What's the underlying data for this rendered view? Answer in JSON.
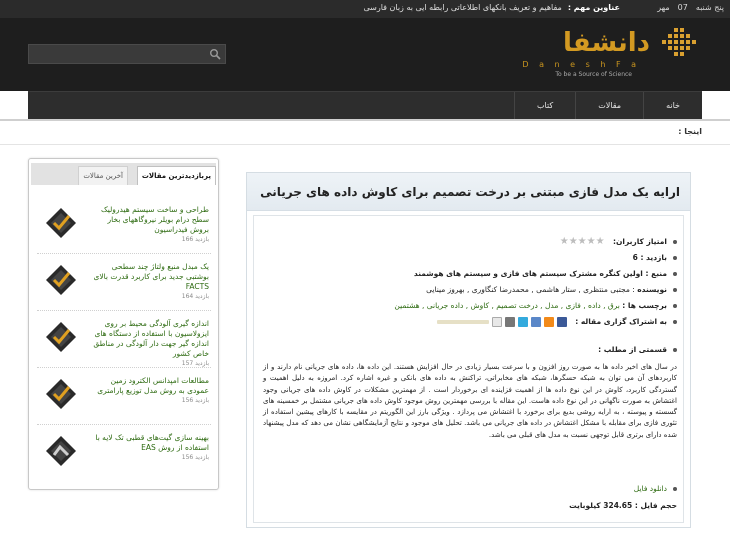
{
  "topbar": {
    "day": "پنج شنبه",
    "date_day": "07",
    "month": "مهر",
    "headlines_label": "عناوین مهم :",
    "headline": "مفاهیم و تعریف بانکهای اطلاعاتی رابطه ایی به زبان فارسی"
  },
  "header": {
    "search_placeholder": "",
    "logo_fa": "دانشفا",
    "logo_en": "D a n e s h  F a",
    "logo_tagline": "To be a Source of Science"
  },
  "nav": {
    "items": [
      "خانه",
      "مقالات",
      "کتاب"
    ]
  },
  "breadcrumb": "اینجا :",
  "sidebar": {
    "tab_active": "پربازدیدترین مقالات",
    "tab_inactive": "آخرین مقالات",
    "entries": [
      {
        "title": "طراحی و ساخت سیستم هیدرولیک سطح درام بویلر نیروگاههای بخار بروش فیدراسیون",
        "views": "بازدید 166"
      },
      {
        "title": "یک مبدل منبع ولتاژ چند سطحی بوشتبی جدید برای کاربرد قدرت بالای FACTS",
        "views": "بازدید 164"
      },
      {
        "title": "اندازه گیری آلودگی محیط بر روی ایزولاسیون با استفاده از دستگاه های اندازه گیر جهت دار آلودگی در مناطق خاص کشور",
        "views": "بازدید 157"
      },
      {
        "title": "مطالعات امپدانس الکترود زمین عمودی به روش مدل توزیع پارامتری",
        "views": "بازدید 156"
      },
      {
        "title": "بهینه سازی گیت‌های قطبی تک لایه با استفاده از روش EAS",
        "views": "بازدید 156"
      }
    ]
  },
  "article": {
    "title": "ارایه یک مدل فازی مبتنی بر درخت تصمیم برای کاوش داده های جریانی",
    "rating_label": "امتیاز کاربران:",
    "rating_value": 0,
    "rating_max": 5,
    "views": "بازدید : 6",
    "source": "منبع : اولین کنگره مشترک سیستم های فازی و سیستم های هوشمند",
    "authors_label": "نویسنده",
    "authors": " : مجتبی منتظری , ستار هاشمی , محمدرضا کنگاوری , بهروز مینایی",
    "tags_label": "برچسب ها :",
    "tags": "برق , داده , فازی , مدل , درخت تصمیم , کاوش , داده جریانی , هشتمین",
    "share_label": "به اشتراک گزاری مقاله :",
    "summary_label": "قسمتی از مطلب :",
    "summary": "در سال های اخیر داده ها به صورت روز افزون و با سرعت بسیار زیادی در حال افزایش هستند. این داده ها، داده های جریانی نام دارند و از کاربردهای آن می توان به شبکه حسگرها، شبکه های مخابراتی، تراکنش به داده های بانکی و غیره اشاره کرد. امروزه به دلیل اهمیت و گستردگی کاربرد، کاوش در این نوع داده ها از اهمیت فزاینده ای برخوردار است . از مهمترین مشکلات در کاوش داده های جریانی وجود اغتشاش به صورت ناگهانی در این نوع داده هاست. این مقاله با بررسی مهمترین روش موجود کاوش داده های جریانی مشتمل بر خمسینه های گسسته و پیوسته ، به ارایه روشی بدیع برای برخورد با اغتشاش می پردازد . ویژگی بارز این الگوریتم در مقایسه با کارهای پیشین استفاده از تئوری فازی برای مقابله با مشکل اغتشاش در داده های جریانی می باشد. تحلیل های موجود و نتایج آزمایشگاهی نشان می دهد که مدل پیشنهاد شده دارای برتری قابل توجهی نسبت به مدل های قبلی می باشد.",
    "download_label": "دانلود فایل",
    "file_size": "حجم فایل : 324.65 کیلوبایت"
  }
}
